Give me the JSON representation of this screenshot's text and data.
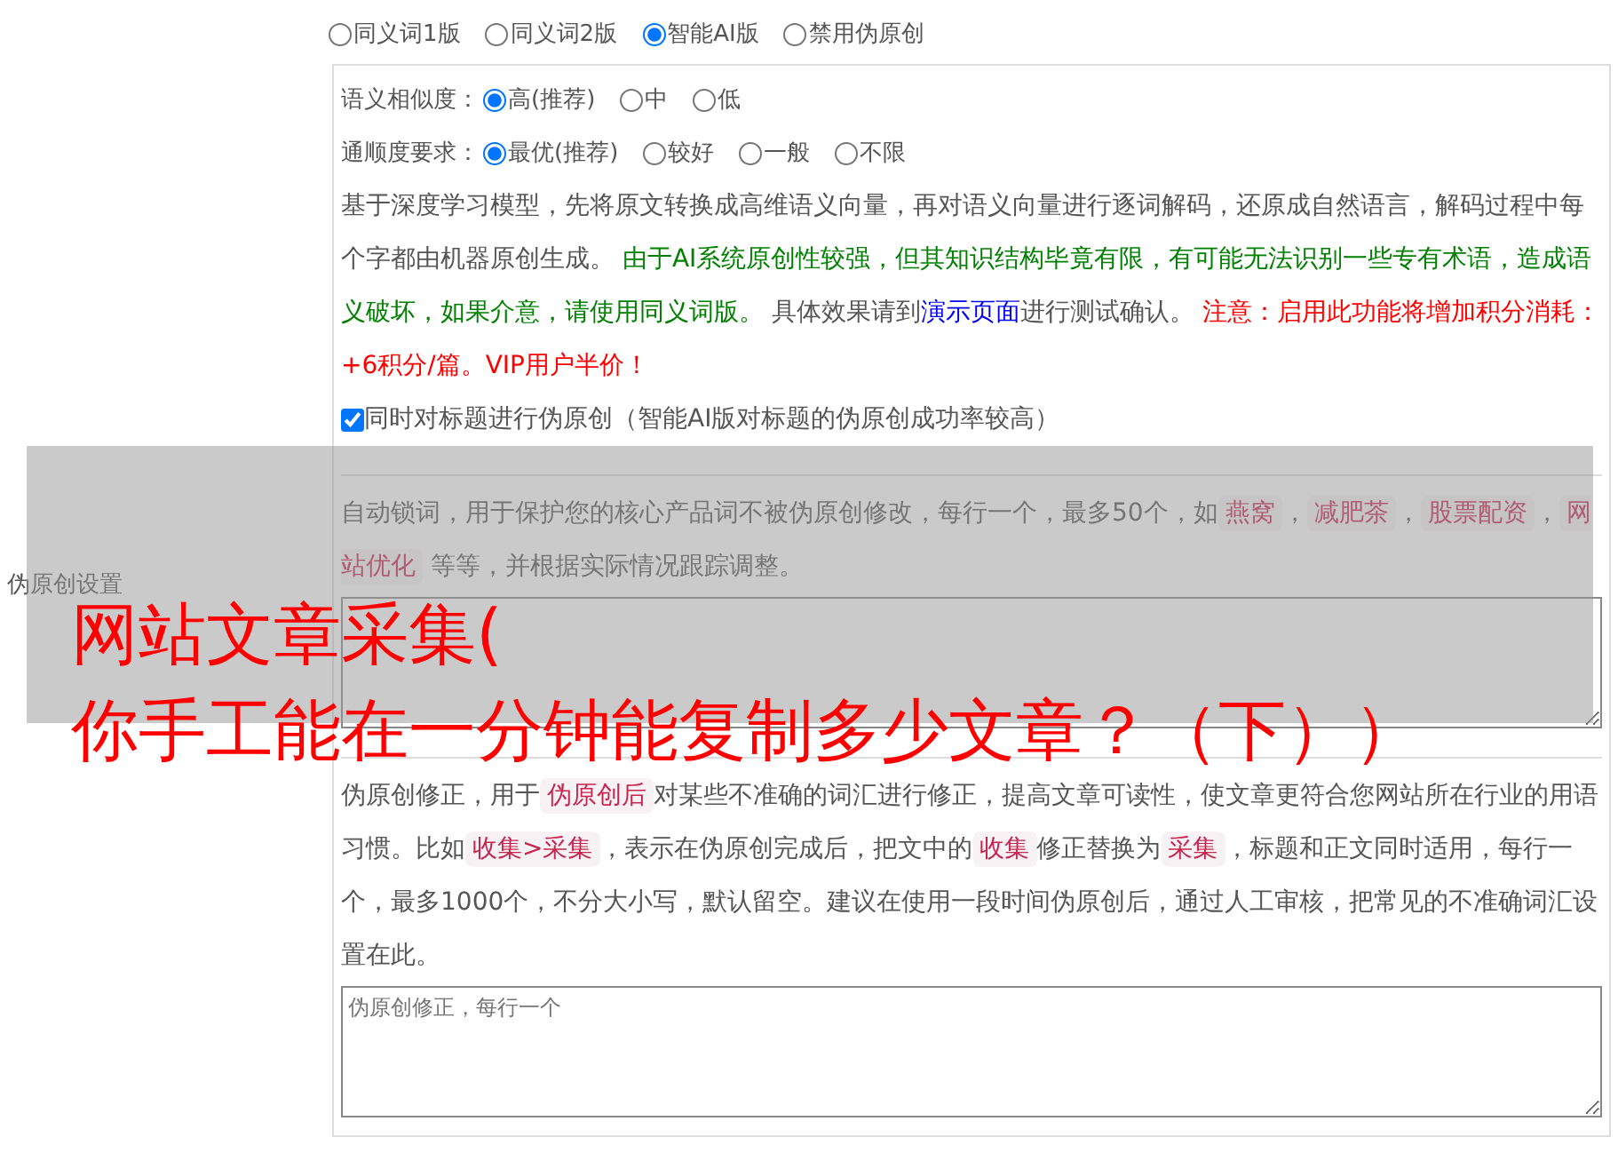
{
  "mode_options": [
    {
      "label": "同义词1版",
      "selected": false
    },
    {
      "label": "同义词2版",
      "selected": false
    },
    {
      "label": "智能AI版",
      "selected": true
    },
    {
      "label": "禁用伪原创",
      "selected": false
    }
  ],
  "section_label": "伪原创设置",
  "ai_settings": {
    "rows": [
      {
        "label": "语义相似度：",
        "options": [
          {
            "label": "高(推荐)",
            "selected": true
          },
          {
            "label": "中",
            "selected": false
          },
          {
            "label": "低",
            "selected": false
          }
        ]
      },
      {
        "label": "通顺度要求：",
        "options": [
          {
            "label": "最优(推荐)",
            "selected": true
          },
          {
            "label": "较好",
            "selected": false
          },
          {
            "label": "一般",
            "selected": false
          },
          {
            "label": "不限",
            "selected": false
          }
        ]
      }
    ],
    "description": [
      {
        "kind": "plain",
        "text": "基于深度学习模型，先将原文转换成高维语义向量，再对语义向量进行逐词解码，还原成自然语言，解码过程中每个字都由机器原创生成。 "
      },
      {
        "kind": "green",
        "text": "由于AI系统原创性较强，但其知识结构毕竟有限，有可能无法识别一些专有术语，造成语义破坏，如果介意，请使用同义词版。"
      },
      {
        "kind": "plain",
        "text": " 具体效果请到"
      },
      {
        "kind": "link",
        "text": "演示页面"
      },
      {
        "kind": "plain",
        "text": "进行测试确认。 "
      },
      {
        "kind": "red",
        "text": "注意：启用此功能将增加积分消耗：+6积分/篇。VIP用户半价！"
      }
    ],
    "title_checkbox": {
      "label": "同时对标题进行伪原创（智能AI版对标题的伪原创成功率较高）",
      "checked": true
    }
  },
  "lock_words": {
    "description": [
      {
        "kind": "plain",
        "text": "自动锁词，用于保护您的核心产品词不被伪原创修改，每行一个，最多50个，如"
      },
      {
        "kind": "code",
        "text": "燕窝"
      },
      {
        "kind": "plain",
        "text": "，"
      },
      {
        "kind": "code",
        "text": "减肥茶"
      },
      {
        "kind": "plain",
        "text": "，"
      },
      {
        "kind": "code",
        "text": "股票配资"
      },
      {
        "kind": "plain",
        "text": "，"
      },
      {
        "kind": "code",
        "text": "网站优化"
      },
      {
        "kind": "plain",
        "text": " 等等，并根据实际情况跟踪调整。"
      }
    ]
  },
  "corrections": {
    "description": [
      {
        "kind": "plain",
        "text": "伪原创修正，用于"
      },
      {
        "kind": "code",
        "text": "伪原创后"
      },
      {
        "kind": "plain",
        "text": "对某些不准确的词汇进行修正，提高文章可读性，使文章更符合您网站所在行业的用语习惯。比如"
      },
      {
        "kind": "code",
        "text": "收集>采集"
      },
      {
        "kind": "plain",
        "text": "，表示在伪原创完成后，把文中的"
      },
      {
        "kind": "code",
        "text": "收集"
      },
      {
        "kind": "plain",
        "text": "修正替换为"
      },
      {
        "kind": "code",
        "text": "采集"
      },
      {
        "kind": "plain",
        "text": "，标题和正文同时适用，每行一个，最多1000个，不分大小写，默认留空。建议在使用一段时间伪原创后，通过人工审核，把常见的不准确词汇设置在此。"
      }
    ],
    "placeholder": "伪原创修正，每行一个"
  },
  "overlay_title": [
    "网站文章采集(",
    "你手工能在一分钟能复制多少文章？（下））"
  ]
}
